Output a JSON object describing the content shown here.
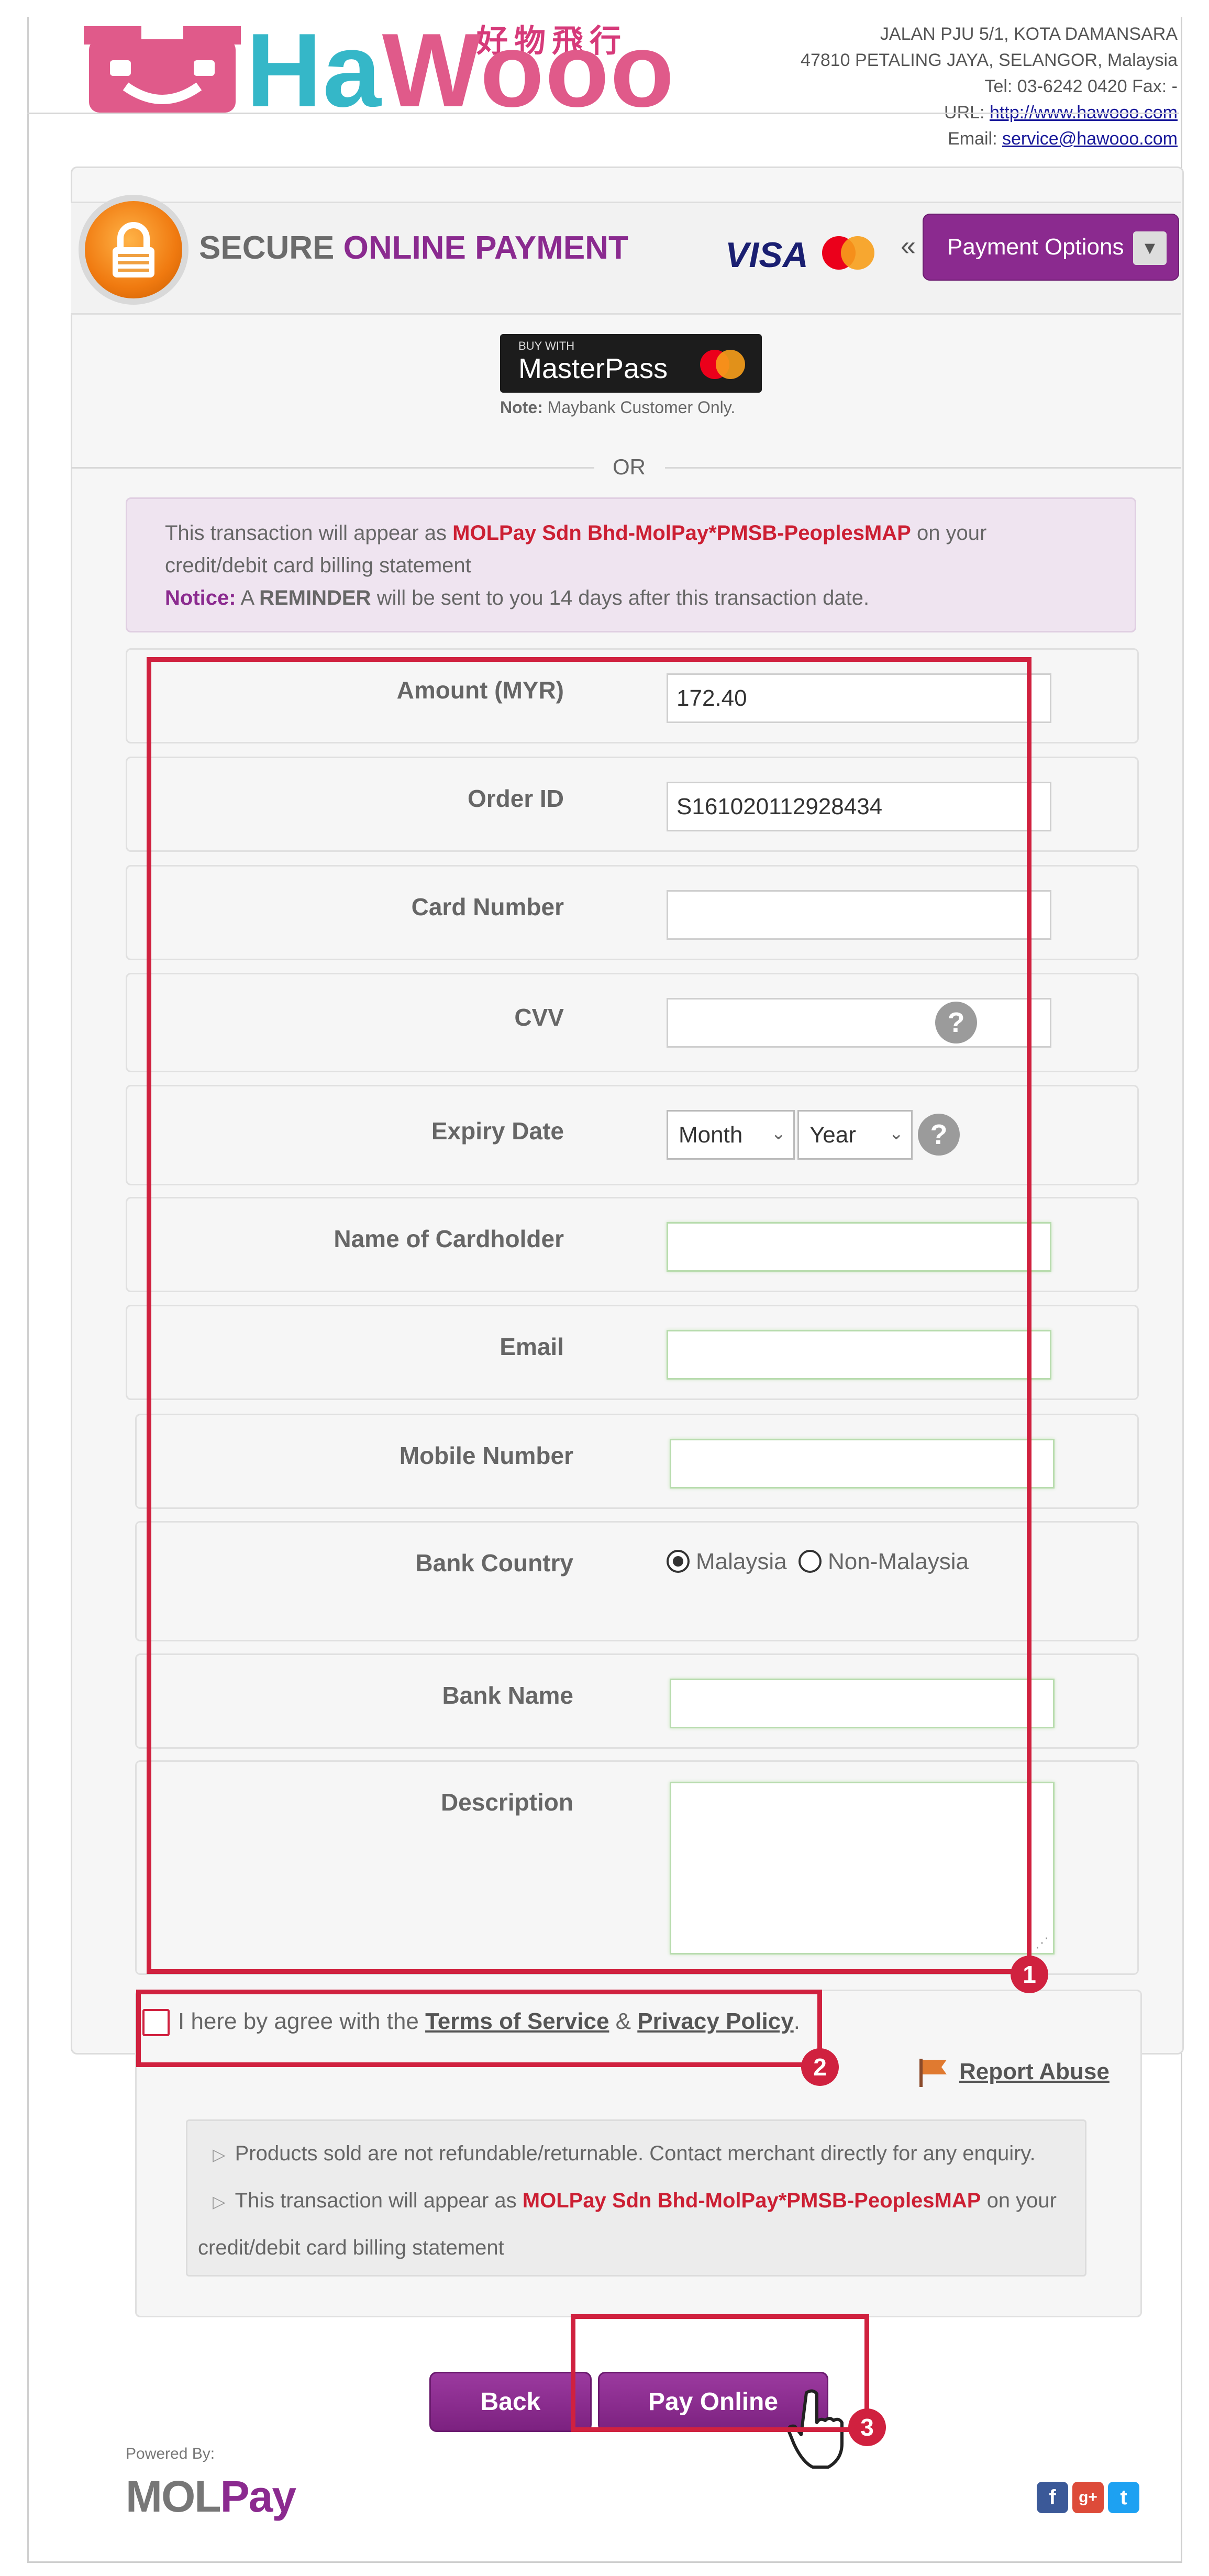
{
  "header": {
    "logo_text": "HaWooo",
    "logo_chinese": "好物飛行",
    "address_lines": [
      "JALAN PJU 5/1, KOTA DAMANSARA",
      "47810 PETALING JAYA, SELANGOR, Malaysia",
      "Tel: 03-6242 0420     Fax: -"
    ],
    "url_label": "URL:",
    "url": "http://www.hawooo.com",
    "email_label": "Email:",
    "email": "service@hawooo.com"
  },
  "payment_header": {
    "title_prefix": "SECURE",
    "title_accent": "ONLINE PAYMENT",
    "visa": "VISA",
    "mastercard": "MasterCard",
    "separator": "«",
    "payment_options_label": "Payment Options"
  },
  "masterpass": {
    "buy_with": "BUY WITH",
    "label": "MasterPass",
    "note_label": "Note:",
    "note": "Maybank Customer Only."
  },
  "or_label": "OR",
  "notice": {
    "line1_prefix": "This transaction will appear as",
    "merchant": "MOLPay Sdn Bhd-MolPay*PMSB-PeoplesMAP",
    "line1_suffix": "on your",
    "line2": "credit/debit card billing statement",
    "notice_label": "Notice:",
    "reminder_prefix": "A",
    "reminder_bold": "REMINDER",
    "reminder_suffix": "will be sent to you 14 days after this transaction date."
  },
  "form": {
    "amount_label": "Amount (MYR)",
    "amount_value": "172.40",
    "order_label": "Order ID",
    "order_value": "S161020112928434",
    "card_label": "Card Number",
    "card_value": "",
    "cvv_label": "CVV",
    "cvv_value": "",
    "expiry_label": "Expiry Date",
    "month": "Month",
    "year": "Year",
    "name_label": "Name of Cardholder",
    "email_label": "Email",
    "mobile_label": "Mobile Number",
    "country_label": "Bank Country",
    "country_options": [
      "Malaysia",
      "Non-Malaysia"
    ],
    "country_selected": "Malaysia",
    "bank_label": "Bank Name",
    "desc_label": "Description",
    "help": "?"
  },
  "agreement": {
    "prefix": "I here by agree with the",
    "terms": "Terms of Service",
    "amp": "&",
    "privacy": "Privacy Policy",
    "suffix": ".",
    "checked": false
  },
  "report_abuse": "Report Abuse",
  "info": {
    "line1": "Products sold are not refundable/returnable. Contact merchant directly for any enquiry.",
    "line2_prefix": "This transaction will appear as",
    "merchant": "MOLPay Sdn Bhd-MolPay*PMSB-PeoplesMAP",
    "line2_suffix": "on your",
    "line3": "credit/debit card billing statement"
  },
  "buttons": {
    "back": "Back",
    "pay": "Pay Online"
  },
  "annotations": [
    "1",
    "2",
    "3"
  ],
  "footer": {
    "powered_by": "Powered By:",
    "brand_mol": "MOL",
    "brand_pay": "Pay",
    "social": [
      "f",
      "g+",
      "t"
    ]
  },
  "colors": {
    "accent": "#8b2a8f",
    "highlight": "#d0213f",
    "merchant_text": "#cc1f33"
  }
}
